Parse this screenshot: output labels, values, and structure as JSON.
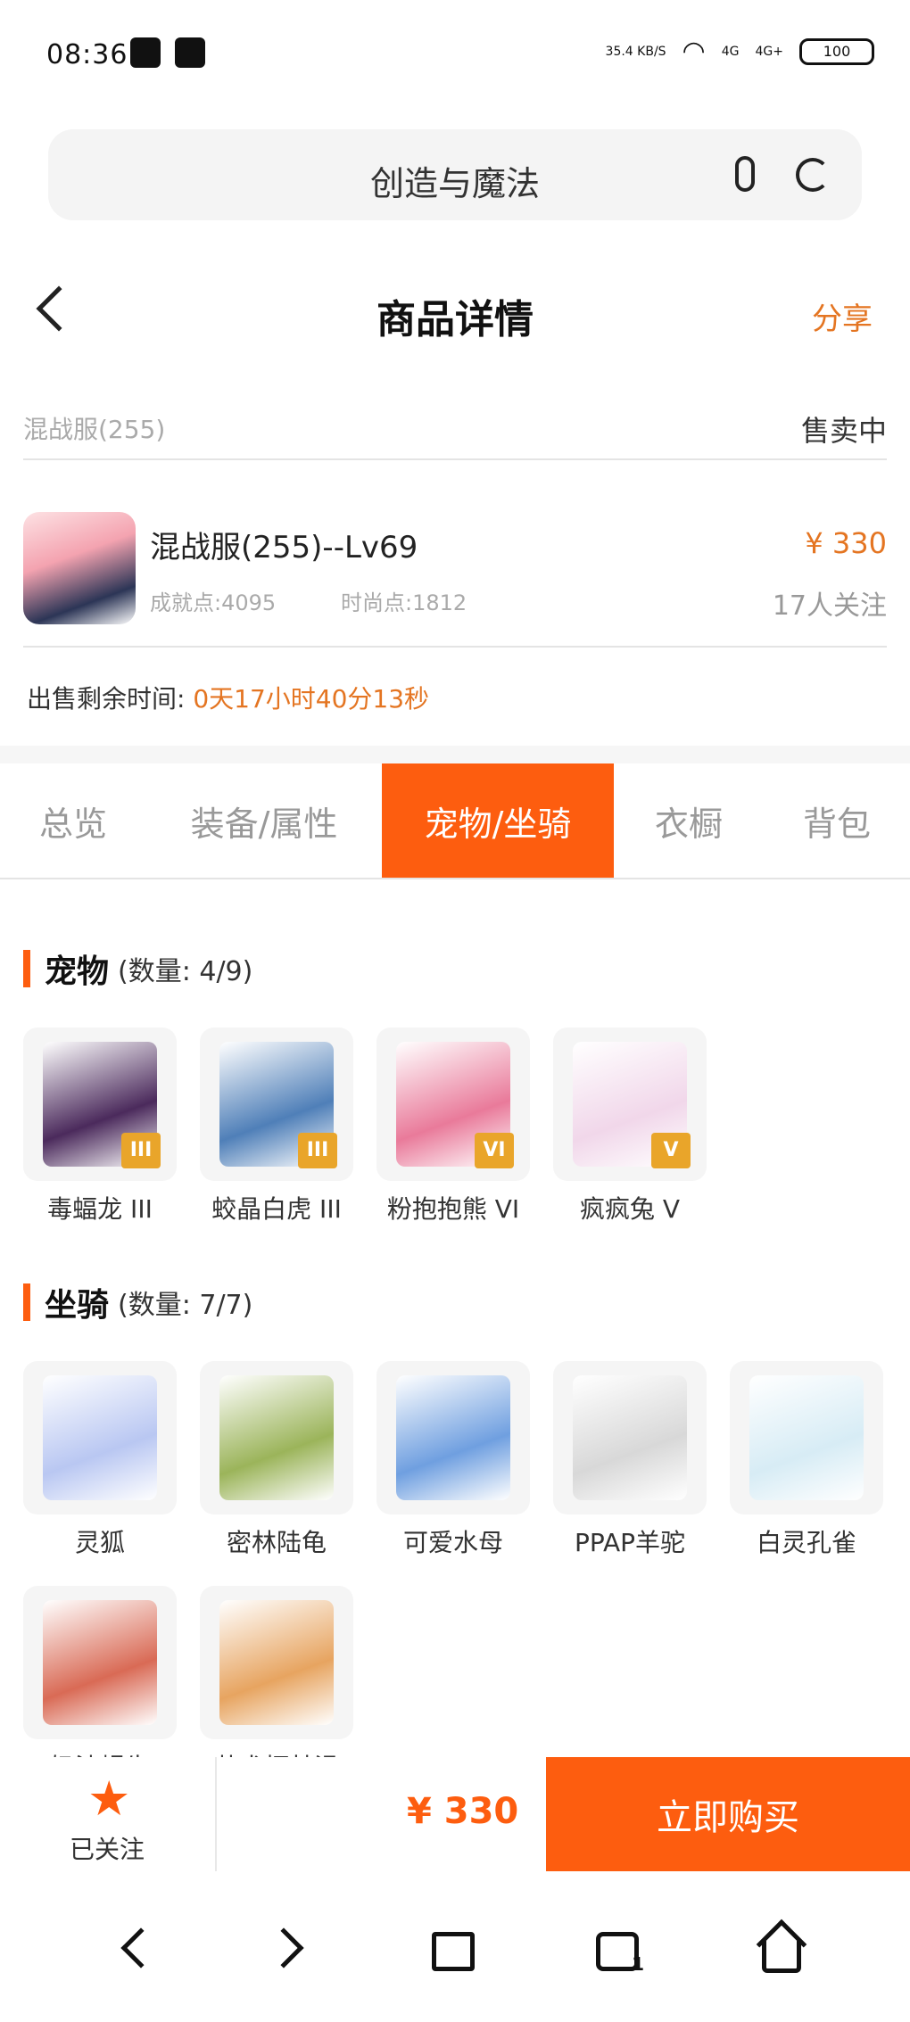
{
  "status_bar": {
    "time": "08:36",
    "net_speed": "35.4 KB/S",
    "signal1": "4G",
    "signal2": "4G+",
    "battery": "100"
  },
  "search": {
    "text": "创造与魔法"
  },
  "header": {
    "title": "商品详情",
    "share": "分享"
  },
  "server": {
    "name": "混战服(255)",
    "status": "售卖中"
  },
  "product": {
    "title": "混战服(255)--Lv69",
    "achievement": "成就点:4095",
    "fashion": "时尚点:1812",
    "price": "¥ 330",
    "followers": "17人关注"
  },
  "remaining": {
    "label": "出售剩余时间:",
    "value": "0天17小时40分13秒"
  },
  "tabs": [
    "总览",
    "装备/属性",
    "宠物/坐骑",
    "衣橱",
    "背包"
  ],
  "active_tab": "宠物/坐骑",
  "pets": {
    "title": "宠物",
    "count": "(数量: 4/9)",
    "items": [
      {
        "name": "毒蝠龙 III",
        "badge": "III",
        "color": "#4b2a5c"
      },
      {
        "name": "蛟晶白虎 III",
        "badge": "III",
        "color": "#4f7fb8"
      },
      {
        "name": "粉抱抱熊 VI",
        "badge": "VI",
        "color": "#e97a9a"
      },
      {
        "name": "疯疯兔 V",
        "badge": "V",
        "color": "#f1d7ea"
      }
    ]
  },
  "mounts": {
    "title": "坐骑",
    "count": "(数量: 7/7)",
    "items": [
      {
        "name": "灵狐",
        "color": "#b9c7f2"
      },
      {
        "name": "密林陆龟",
        "color": "#9bb45a"
      },
      {
        "name": "可爱水母",
        "color": "#6f9fe0"
      },
      {
        "name": "PPAP羊驼",
        "color": "#d8d8d8"
      },
      {
        "name": "白灵孔雀",
        "color": "#d7ecf5"
      },
      {
        "name": "奶油蜗牛",
        "color": "#d96a55"
      },
      {
        "name": "萌犬柯基滑",
        "color": "#e7a460"
      }
    ]
  },
  "bottom": {
    "follow_label": "已关注",
    "total": "¥ 330",
    "buy_label": "立即购买"
  }
}
